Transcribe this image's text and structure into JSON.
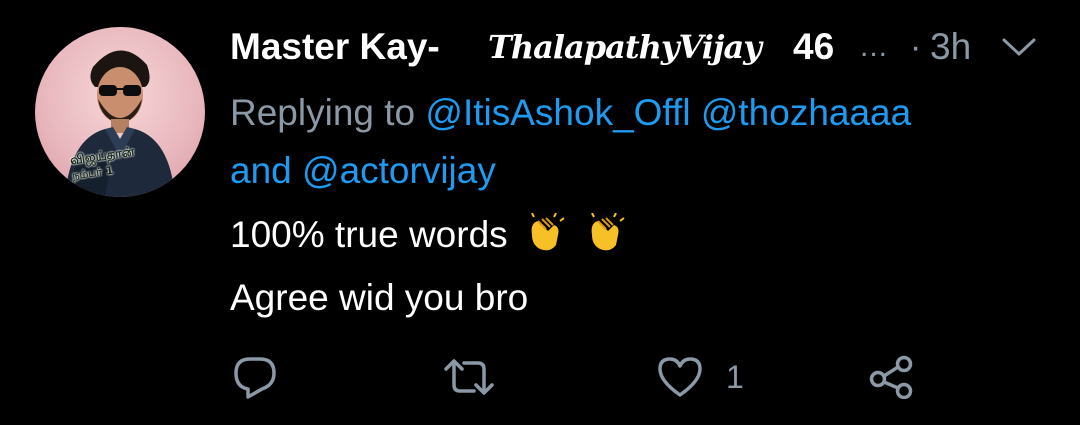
{
  "colors": {
    "background": "#000000",
    "text": "#FFFFFF",
    "muted": "#8B98A5",
    "link": "#1D9BF0"
  },
  "tweet": {
    "avatar_caption_line1": "விஜய்தான்",
    "avatar_caption_line2": "நம்பர் 1",
    "display_name": "Master Kay-",
    "display_name_script": "ThalapathyVijay",
    "display_name_suffix": "46",
    "ellipsis": "...",
    "dot": "·",
    "timestamp": "3h",
    "more_icon": "chevron-down-icon",
    "replying_prefix": "Replying to",
    "mention_1": "@ItisAshok_Offl",
    "mention_2": "@thozhaaaa",
    "replying_and": "and",
    "mention_3": "@actorvijay",
    "line_1": "100% true words",
    "line_1_emojis": "clapping-hands-icon x2",
    "line_2": "Agree wid you bro",
    "actions": {
      "reply_icon": "reply-icon",
      "retweet_icon": "retweet-icon",
      "like_icon": "heart-icon",
      "like_count": "1",
      "share_icon": "share-icon"
    }
  }
}
